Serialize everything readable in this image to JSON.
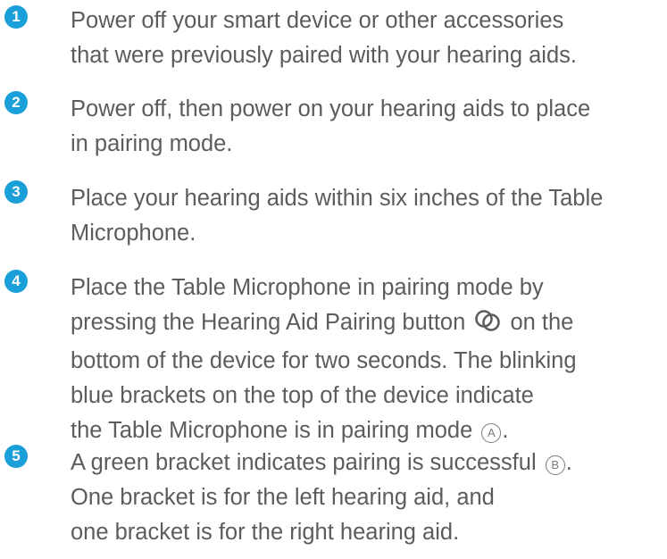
{
  "steps": [
    {
      "number": "1",
      "text": "Power off your smart device or other accessories\nthat were previously paired with your hearing aids."
    },
    {
      "number": "2",
      "text": "Power off, then power on your hearing aids to place\nin pairing mode."
    },
    {
      "number": "3",
      "text": "Place your hearing aids within six inches of the Table\nMicrophone."
    },
    {
      "number": "4",
      "text_before_icon": "Place the Table Microphone in pairing mode by\npressing the Hearing Aid Pairing button",
      "icon": "pairing-icon",
      "text_after_icon": " on the\nbottom of the device for two seconds. The blinking\nblue brackets on the top of the device indicate\nthe Table Microphone is in pairing mode",
      "marker": "A",
      "text_end": "."
    },
    {
      "number": "5",
      "text_before_marker": "A green bracket indicates pairing is successful",
      "marker": "B",
      "text_after_marker": ".\nOne bracket is for the left hearing aid, and\none bracket is for the right hearing aid."
    }
  ],
  "colors": {
    "accent": "#1a9fd9",
    "text": "#5c5c5c"
  }
}
